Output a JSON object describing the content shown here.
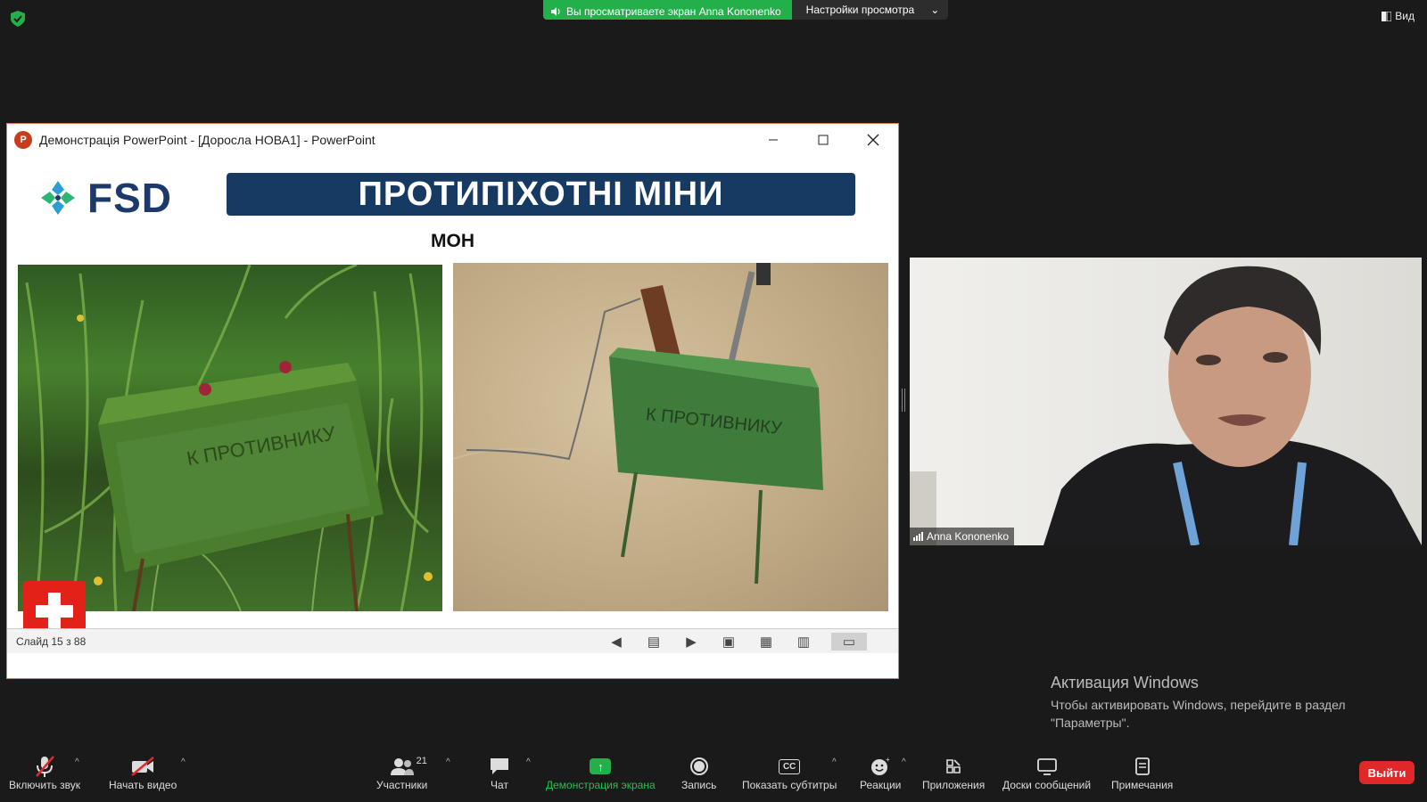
{
  "top": {
    "sharing_banner": "Вы просматриваете экран Anna Kononenko",
    "view_settings": "Настройки просмотра",
    "view_button": "Вид"
  },
  "ppt": {
    "window_title": "Демонстрація PowerPoint - [Доросла НОВА1] - PowerPoint",
    "logo_letter": "P",
    "slide": {
      "logo_text": "FSD",
      "title": "ПРОТИПІХОТНІ МІНИ",
      "subtitle": "МОН",
      "mine_label_left": "К ПРОТИВНИКУ",
      "mine_label_right": "К ПРОТИВНИКУ"
    },
    "status": "Слайд 15 з 88"
  },
  "participant": {
    "name": "Anna Kononenko"
  },
  "windows_activation": {
    "title": "Активация Windows",
    "line1": "Чтобы активировать Windows, перейдите в раздел",
    "line2": "\"Параметры\"."
  },
  "toolbar": {
    "mute": "Включить звук",
    "video": "Начать видео",
    "participants": "Участники",
    "participants_count": "21",
    "chat": "Чат",
    "share": "Демонстрация экрана",
    "record": "Запись",
    "captions": "Показать субтитры",
    "captions_icon": "CC",
    "reactions": "Реакции",
    "apps": "Приложения",
    "whiteboards": "Доски сообщений",
    "notes": "Примечания",
    "leave": "Выйти"
  },
  "colors": {
    "accent_green": "#23b04a",
    "leave_red": "#e02828",
    "slide_title_bg": "#173a63"
  }
}
